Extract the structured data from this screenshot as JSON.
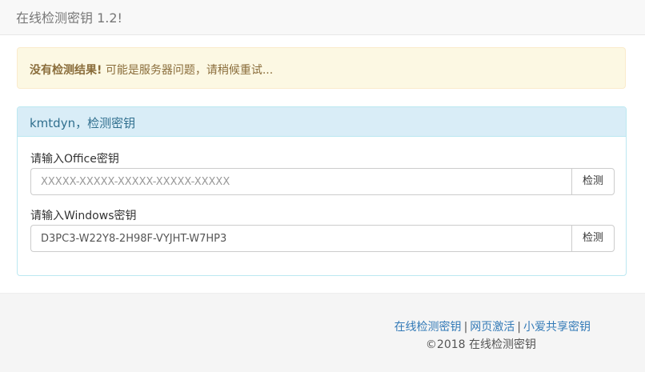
{
  "navbar": {
    "brand": "在线检测密钥 1.2!"
  },
  "alert": {
    "strong_text": "没有检测结果!",
    "message": " 可能是服务器问题，请稍候重试..."
  },
  "panel": {
    "heading": "kmtdyn，检测密钥",
    "office": {
      "label": "请输入Office密钥",
      "placeholder": "XXXXX-XXXXX-XXXXX-XXXXX-XXXXX",
      "value": "",
      "button": "检测"
    },
    "windows": {
      "label": "请输入Windows密钥",
      "placeholder": "",
      "value": "D3PC3-W22Y8-2H98F-VYJHT-W7HP3",
      "button": "检测"
    }
  },
  "footer": {
    "links": [
      "在线检测密钥",
      "网页激活",
      "小爱共享密钥"
    ],
    "separator": "|",
    "copyright": "©2018 在线检测密钥"
  },
  "colors": {
    "alert_bg": "#fcf8e3",
    "alert_text": "#8a6d3b",
    "panel_heading_bg": "#d9edf7",
    "panel_heading_text": "#31708f",
    "link": "#337ab7"
  }
}
